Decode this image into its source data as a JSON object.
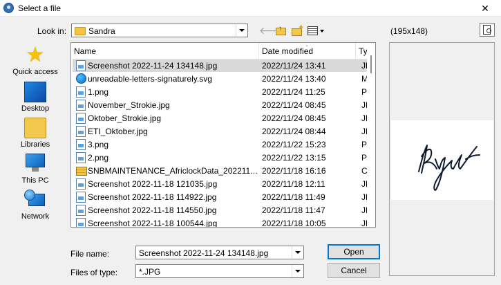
{
  "window": {
    "title": "Select a file",
    "close_glyph": "✕",
    "icon": "app-icon"
  },
  "toolbar": {
    "look_in_label": "Look in:",
    "look_in_value": "Sandra",
    "icons": [
      "back-arrow-icon",
      "up-folder-icon",
      "new-folder-icon",
      "view-menu-icon"
    ]
  },
  "preview": {
    "dimensions": "(195x148)",
    "icon": "preview-toggle-icon"
  },
  "places": [
    {
      "label": "Quick access",
      "icon": "star-icon"
    },
    {
      "label": "Desktop",
      "icon": "desktop-icon"
    },
    {
      "label": "Libraries",
      "icon": "libraries-icon"
    },
    {
      "label": "This PC",
      "icon": "this-pc-icon"
    },
    {
      "label": "Network",
      "icon": "network-icon"
    }
  ],
  "file_list": {
    "columns": {
      "name": "Name",
      "date": "Date modified",
      "type": "Ty"
    },
    "rows": [
      {
        "name": "Screenshot 2022-11-24 134148.jpg",
        "date": "2022/11/24 13:41",
        "type": "JP",
        "icon": "image-file-icon",
        "selected": true
      },
      {
        "name": "unreadable-letters-signaturely.svg",
        "date": "2022/11/24 13:40",
        "type": "M",
        "icon": "edge-svg-file-icon"
      },
      {
        "name": "1.png",
        "date": "2022/11/24 11:25",
        "type": "PN",
        "icon": "image-file-icon"
      },
      {
        "name": "November_Strokie.jpg",
        "date": "2022/11/24 08:45",
        "type": "JP",
        "icon": "image-file-icon"
      },
      {
        "name": "Oktober_Strokie.jpg",
        "date": "2022/11/24 08:45",
        "type": "JP",
        "icon": "image-file-icon"
      },
      {
        "name": "ETI_Oktober.jpg",
        "date": "2022/11/24 08:44",
        "type": "JP",
        "icon": "image-file-icon"
      },
      {
        "name": "3.png",
        "date": "2022/11/22 15:23",
        "type": "PN",
        "icon": "image-file-icon"
      },
      {
        "name": "2.png",
        "date": "2022/11/22 13:15",
        "type": "PN",
        "icon": "image-file-icon"
      },
      {
        "name": "SNBMAINTENANCE_AfriclockData_2022111...",
        "date": "2022/11/18 16:16",
        "type": "Co",
        "icon": "zip-folder-icon"
      },
      {
        "name": "Screenshot 2022-11-18 121035.jpg",
        "date": "2022/11/18 12:11",
        "type": "JP",
        "icon": "image-file-icon"
      },
      {
        "name": "Screenshot 2022-11-18 114922.jpg",
        "date": "2022/11/18 11:49",
        "type": "JP",
        "icon": "image-file-icon"
      },
      {
        "name": "Screenshot 2022-11-18 114550.jpg",
        "date": "2022/11/18 11:47",
        "type": "JP",
        "icon": "image-file-icon"
      },
      {
        "name": "Screenshot 2022-11-18 100544.jpg",
        "date": "2022/11/18 10:05",
        "type": "JP",
        "icon": "image-file-icon"
      }
    ]
  },
  "form": {
    "file_name_label": "File name:",
    "file_name_value": "Screenshot 2022-11-24 134148.jpg",
    "file_type_label": "Files of type:",
    "file_type_value": "*.JPG"
  },
  "buttons": {
    "open": "Open",
    "cancel": "Cancel"
  },
  "colors": {
    "selection": "#d9d9d9",
    "default_button_border": "#0078d7",
    "folder": "#f5c342"
  }
}
